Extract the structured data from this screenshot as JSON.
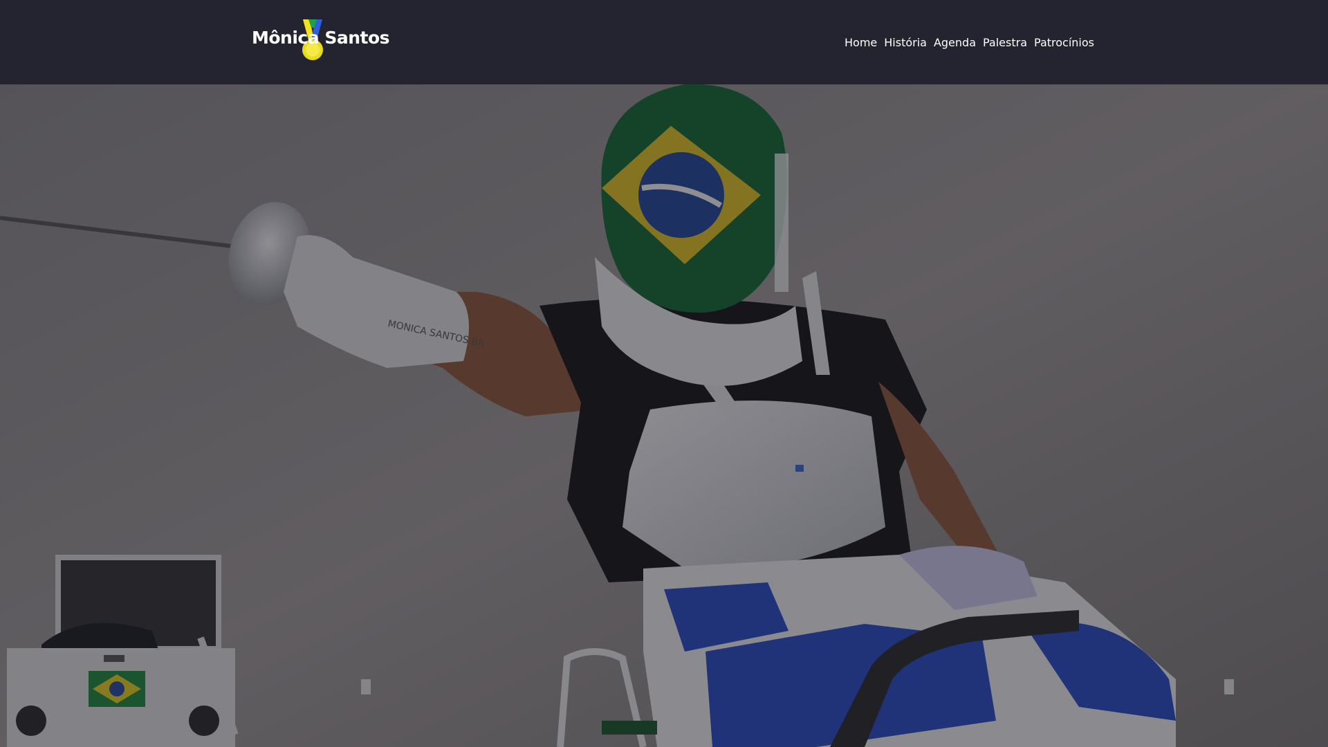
{
  "brand": {
    "name": "Mônica Santos"
  },
  "nav": {
    "items": [
      {
        "label": "Home"
      },
      {
        "label": "História"
      },
      {
        "label": "Agenda"
      },
      {
        "label": "Palestra"
      },
      {
        "label": "Patrocínios"
      }
    ]
  },
  "hero": {
    "image": "wheelchair-fencer-photo",
    "glove_text": "MONICA SANTOS BR"
  },
  "colors": {
    "header_bg": "#242430",
    "nav_text": "#ffffff",
    "medal_gold": "#f4e21a",
    "medal_blue": "#2f5fd6",
    "medal_green": "#1aa34a",
    "overlay": "rgba(20,20,30,0.45)"
  }
}
